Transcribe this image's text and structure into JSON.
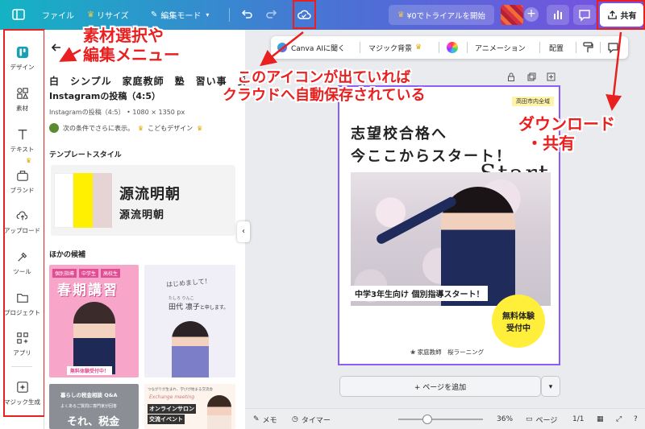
{
  "topbar": {
    "file": "ファイル",
    "resize": "リサイズ",
    "edit_mode": "編集モード",
    "trial": "¥0でトライアルを開始",
    "share": "共有"
  },
  "sidebar": {
    "items": [
      {
        "label": "デザイン",
        "icon": "design-icon"
      },
      {
        "label": "素材",
        "icon": "elements-icon"
      },
      {
        "label": "テキスト",
        "icon": "text-icon"
      },
      {
        "label": "ブランド",
        "icon": "brand-icon"
      },
      {
        "label": "アップロード",
        "icon": "upload-icon"
      },
      {
        "label": "ツール",
        "icon": "tools-icon"
      },
      {
        "label": "プロジェクト",
        "icon": "folder-icon"
      },
      {
        "label": "アプリ",
        "icon": "apps-icon"
      },
      {
        "label": "マジック生成",
        "icon": "magic-icon"
      }
    ]
  },
  "panel": {
    "title": "白　シンプル　家庭教師　塾　習い事　受",
    "subtitle": "Instagramの投稿（4:5）",
    "meta": "Instagramの投稿（4:5） • 1080 × 1350 px",
    "cond": "次の条件でさらに表示。",
    "cond_author": "こどもデザイン",
    "style_label": "テンプレートスタイル",
    "font_big": "源流明朝",
    "font_small": "源流明朝",
    "other_label": "ほかの候補",
    "swatches": [
      "#ffffff",
      "#ffef00",
      "#e6d3d3"
    ]
  },
  "thumbs": {
    "t1_badges": [
      "個別指導",
      "中学生",
      "高校生"
    ],
    "t1_title": "春期講習",
    "t1_cta": "無料体験受付中！",
    "t2_hello": "はじめまして！",
    "t2_kana": "たしろ りんこ",
    "t2_name": "田代 凛子",
    "t2_tail": "と申します。",
    "t3_top": "暮らしの税金相談 Q&A",
    "t3_sub": "よくあるご質問に専門家が回答",
    "t3_big": "それ、税金",
    "t4_top": "つながりが生まれ、学びが始まる交流会",
    "t4_script": "Exchange meeting",
    "t4_title": "オンラインサロン",
    "t4_sub": "交流イベント"
  },
  "toolbar": {
    "canva_ai": "Canva AIに聞く",
    "magic_bg": "マジック背景",
    "animation": "アニメーション",
    "position": "配置"
  },
  "design": {
    "tag": "高田市内全域",
    "line1": "志望校合格へ",
    "line2": "今ここからスタート！",
    "start": "Start",
    "caption": "中学3年生向け 個別指導スタート！",
    "circle1": "無料体験",
    "circle2": "受付中",
    "footer": "家庭教師　桜ラーニング"
  },
  "canvas": {
    "add_page": "+ ページを追加"
  },
  "footer": {
    "memo": "メモ",
    "timer": "タイマー",
    "zoom": "36%",
    "pages": "ページ",
    "page_count": "1/1"
  },
  "annotations": {
    "a1_line1": "素材選択や",
    "a1_line2": "編集メニュー",
    "a2_line1": "このアイコンが出ていれば",
    "a2_line2": "クラウドへ自動保存されている",
    "a3_line1": "ダウンロード",
    "a3_line2": "・共有"
  },
  "colors": {
    "accent_red": "#e82020",
    "selection": "#8b5cf6",
    "highlight": "#ffef00"
  }
}
